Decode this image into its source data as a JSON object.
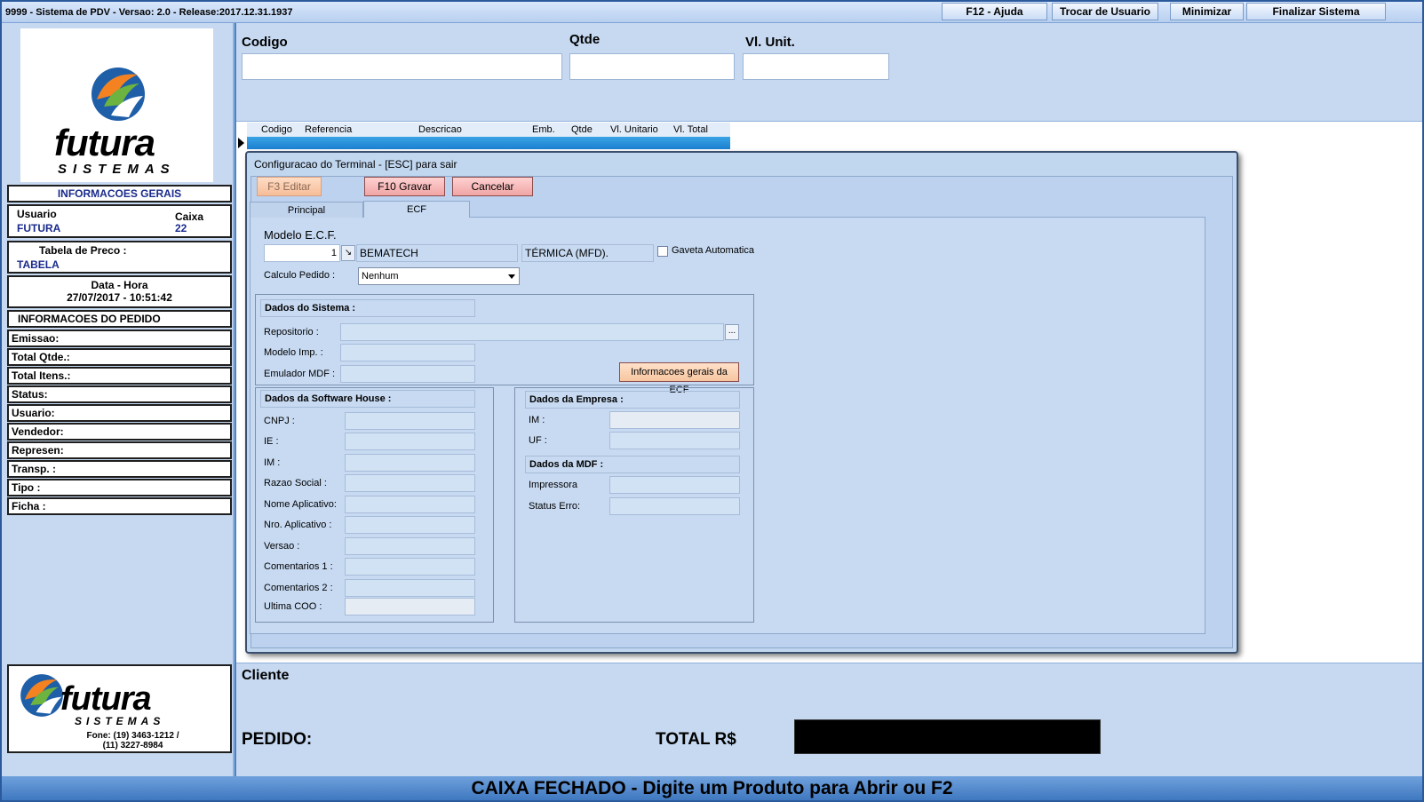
{
  "window": {
    "title": "9999 - Sistema de PDV - Versao: 2.0 - Release:2017.12.31.1937",
    "buttons": {
      "help": "F12 - Ajuda",
      "switch_user": "Trocar de Usuario",
      "minimize": "Minimizar",
      "quit": "Finalizar Sistema"
    }
  },
  "sidebar": {
    "logo": {
      "brand": "futura",
      "tagline": "SISTEMAS"
    },
    "info_title": "INFORMACOES GERAIS",
    "usuario_label": "Usuario",
    "usuario_value": "FUTURA",
    "caixa_label": "Caixa",
    "caixa_value": "22",
    "tabela_label": "Tabela de Preco :",
    "tabela_value": "TABELA",
    "datahora_label": "Data - Hora",
    "datahora_value": "27/07/2017 - 10:51:42",
    "pedido_title": "INFORMACOES DO PEDIDO",
    "pedido_fields": [
      "Emissao:",
      "Total Qtde.:",
      "Total Itens.:",
      "Status:",
      "Usuario:",
      "Vendedor:",
      "Represen:",
      "Transp. :",
      "Tipo :",
      "Ficha :"
    ],
    "footer_logo": {
      "brand": "futura",
      "tagline": "SISTEMAS",
      "phone": "Fone: (19) 3463-1212 /",
      "phone2": "(11) 3227-8984"
    }
  },
  "entry": {
    "codigo_label": "Codigo",
    "qtde_label": "Qtde",
    "vlunit_label": "Vl. Unit."
  },
  "grid": {
    "columns": [
      "Codigo",
      "Referencia",
      "Descricao",
      "Emb.",
      "Qtde",
      "Vl. Unitario",
      "Vl. Total"
    ]
  },
  "dialog": {
    "title": "Configuracao do Terminal - [ESC] para sair",
    "btn_edit": "F3 Editar",
    "btn_save": "F10 Gravar",
    "btn_cancel": "Cancelar",
    "tabs": [
      "Principal",
      "ECF"
    ],
    "modelo_ecf_label": "Modelo E.C.F.",
    "modelo_num": "1",
    "modelo_nome": "BEMATECH",
    "modelo_tipo": "TÉRMICA (MFD).",
    "gaveta_label": "Gaveta Automatica",
    "calculo_label": "Calculo Pedido :",
    "calculo_value": "Nenhum",
    "sistema": {
      "title": "Dados do Sistema :",
      "repositorio": "Repositorio :",
      "browse": "...",
      "modelo_imp": "Modelo Imp. :",
      "emulador": "Emulador MDF :",
      "info_btn": "Informacoes gerais da ECF"
    },
    "software_house": {
      "title": "Dados da Software House :",
      "fields": [
        "CNPJ :",
        "IE :",
        "IM :",
        "Razao Social :",
        "Nome Aplicativo:",
        "Nro. Aplicativo :",
        "Versao :",
        "Comentarios 1 :",
        "Comentarios 2 :",
        "Ultima COO :"
      ]
    },
    "empresa": {
      "title": "Dados da Empresa :",
      "im": "IM :",
      "uf": "UF :"
    },
    "mdf": {
      "title": "Dados da MDF :",
      "impressora": "Impressora",
      "status": "Status Erro:"
    }
  },
  "bottom": {
    "cliente_label": "Cliente",
    "pedido_label": "PEDIDO:",
    "total_label": "TOTAL R$"
  },
  "status_bar": "CAIXA FECHADO - Digite um Produto para Abrir ou F2",
  "colors": {
    "accent_blue": "#4f84c4",
    "panel": "#c6d9f1",
    "button_red": "#f0a4a4"
  }
}
